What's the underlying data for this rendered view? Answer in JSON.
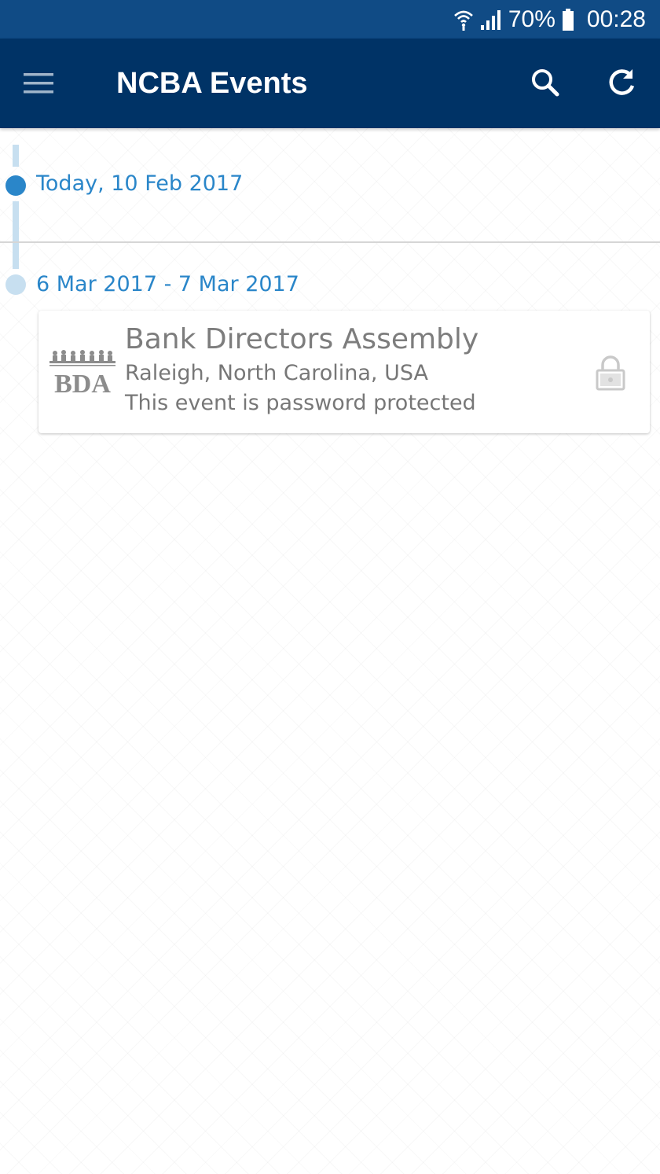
{
  "status_bar": {
    "battery_percent": "70%",
    "time": "00:28",
    "icons": [
      "wifi-icon",
      "signal-icon",
      "battery-icon"
    ]
  },
  "app_bar": {
    "title": "NCBA Events",
    "icons": [
      "menu-icon",
      "search-icon",
      "refresh-icon"
    ]
  },
  "timeline": [
    {
      "date": "Today, 10 Feb 2017",
      "state": "current",
      "events": []
    },
    {
      "date": "6 Mar 2017 - 7 Mar 2017",
      "state": "upcoming",
      "events": [
        {
          "title": "Bank Directors Assembly",
          "location": "Raleigh, North Carolina, USA",
          "note": "This event is password protected",
          "logo_text": "BDA",
          "icon": "lock-icon"
        }
      ]
    }
  ],
  "colors": {
    "status_bar": "#104b85",
    "app_bar": "#003366",
    "accent": "#2a86c9",
    "timeline_light": "#c7dff0"
  }
}
